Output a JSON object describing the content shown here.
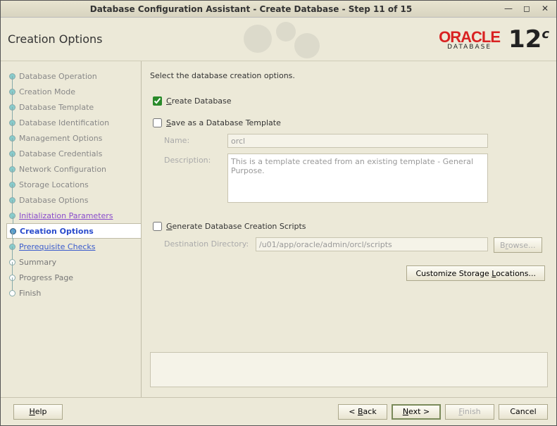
{
  "window": {
    "title": "Database Configuration Assistant - Create Database - Step 11 of 15"
  },
  "header": {
    "title": "Creation Options",
    "brand": "ORACLE",
    "brand_sub": "DATABASE",
    "version": "12",
    "version_suffix": "c"
  },
  "sidebar": {
    "items": [
      {
        "label": "Database Operation",
        "state": "done"
      },
      {
        "label": "Creation Mode",
        "state": "done"
      },
      {
        "label": "Database Template",
        "state": "done"
      },
      {
        "label": "Database Identification",
        "state": "done"
      },
      {
        "label": "Management Options",
        "state": "done"
      },
      {
        "label": "Database Credentials",
        "state": "done"
      },
      {
        "label": "Network Configuration",
        "state": "done"
      },
      {
        "label": "Storage Locations",
        "state": "done"
      },
      {
        "label": "Database Options",
        "state": "done"
      },
      {
        "label": "Initialization Parameters",
        "state": "linkv"
      },
      {
        "label": "Creation Options",
        "state": "current"
      },
      {
        "label": "Prerequisite Checks",
        "state": "link"
      },
      {
        "label": "Summary",
        "state": "upcoming"
      },
      {
        "label": "Progress Page",
        "state": "upcoming"
      },
      {
        "label": "Finish",
        "state": "upcoming"
      }
    ]
  },
  "main": {
    "instruction": "Select the database creation options.",
    "create_db": {
      "label_pre": "",
      "label_key": "C",
      "label_post": "reate Database",
      "checked": true
    },
    "save_tpl": {
      "label_key": "S",
      "label_post": "ave as a Database Template",
      "checked": false,
      "name_label": "Name:",
      "name_value": "orcl",
      "desc_label": "Description:",
      "desc_value": "This is a template created from an existing template - General Purpose."
    },
    "gen_scripts": {
      "label_key": "G",
      "label_post": "enerate Database Creation Scripts",
      "checked": false,
      "dest_label": "Destination Directory:",
      "dest_value": "/u01/app/oracle/admin/orcl/scripts",
      "browse_label": "Browse...",
      "browse_key": "r"
    },
    "customize_btn": "Customize Storage Locations...",
    "customize_key": "L"
  },
  "footer": {
    "help": "Help",
    "help_key": "H",
    "back": "< Back",
    "back_key": "B",
    "next": "Next >",
    "next_key": "N",
    "finish": "Finish",
    "finish_key": "F",
    "cancel": "Cancel"
  }
}
